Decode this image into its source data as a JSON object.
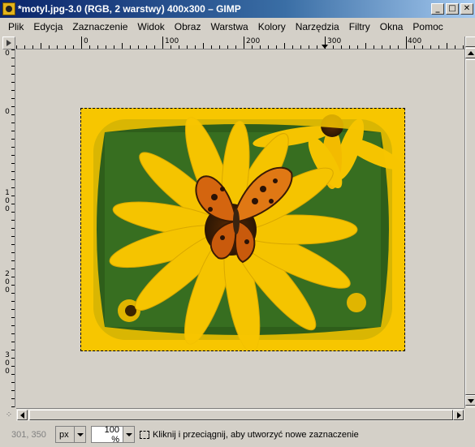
{
  "window": {
    "title": "*motyl.jpg-3.0 (RGB, 2 warstwy) 400x300 – GIMP",
    "buttons": [
      "_",
      "□",
      "✕"
    ]
  },
  "menu": [
    "Plik",
    "Edycja",
    "Zaznaczenie",
    "Widok",
    "Obraz",
    "Warstwa",
    "Kolory",
    "Narzędzia",
    "Filtry",
    "Okna",
    "Pomoc"
  ],
  "rulers": {
    "horizontal_labels": [
      "0",
      "100",
      "200",
      "300",
      "400"
    ],
    "vertical_labels": [
      "0",
      "100",
      "200",
      "300"
    ]
  },
  "image": {
    "description_colors": {
      "frame": "#f7c600",
      "petal": "#f5c400",
      "leaf": "#2f6b1c",
      "butterfly": "#d4650f"
    }
  },
  "status": {
    "coords": "301, 350",
    "unit": "px",
    "zoom": "100 %",
    "message": "Kliknij i przeciągnij, aby utworzyć nowe zaznaczenie"
  }
}
